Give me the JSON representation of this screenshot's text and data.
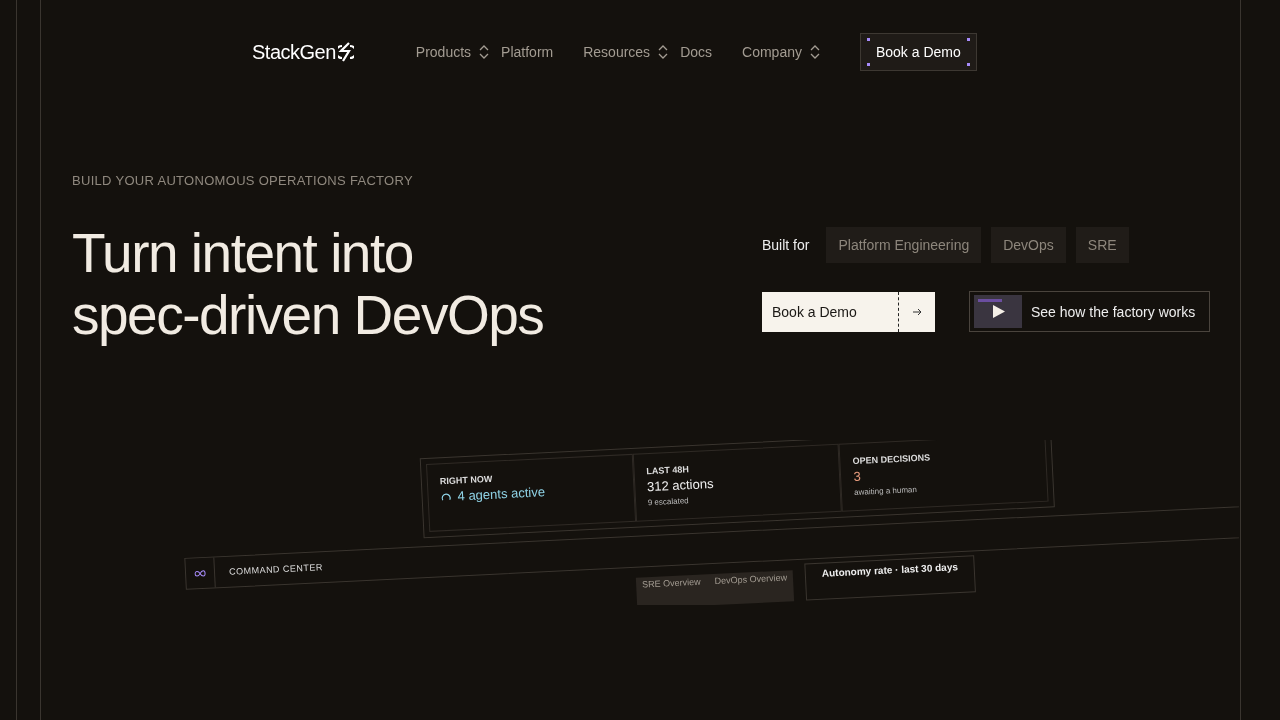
{
  "nav": {
    "logo": "StackGen",
    "items": [
      {
        "label": "Products",
        "dropdown": true
      },
      {
        "label": "Platform",
        "dropdown": false
      },
      {
        "label": "Resources",
        "dropdown": true
      },
      {
        "label": "Docs",
        "dropdown": false
      },
      {
        "label": "Company",
        "dropdown": true
      }
    ],
    "cta": "Book a Demo"
  },
  "hero": {
    "eyebrow": "BUILD YOUR AUTONOMOUS OPERATIONS FACTORY",
    "title_lines": [
      "Turn intent into",
      "spec-driven DevOps"
    ],
    "built_for_label": "Built for",
    "audiences": [
      "Platform Engineering",
      "DevOps",
      "SRE"
    ],
    "primary_button": "Book a Demo",
    "video_button": "See how the factory works"
  },
  "dashboard": {
    "stats": [
      {
        "label": "RIGHT NOW",
        "value": "4 agents active",
        "kind": "active"
      },
      {
        "label": "LAST 48H",
        "value": "312 actions",
        "kind": "plain",
        "note": "9 escalated"
      },
      {
        "label": "OPEN DECISIONS",
        "value": "3",
        "kind": "alert",
        "note": "awaiting a human"
      }
    ],
    "title": "COMMAND CENTER",
    "tabs": [
      {
        "label": "SRE Overview",
        "selected": false
      },
      {
        "label": "DevOps Overview",
        "selected": false
      }
    ],
    "chart_title": "Autonomy rate · last 30 days"
  }
}
